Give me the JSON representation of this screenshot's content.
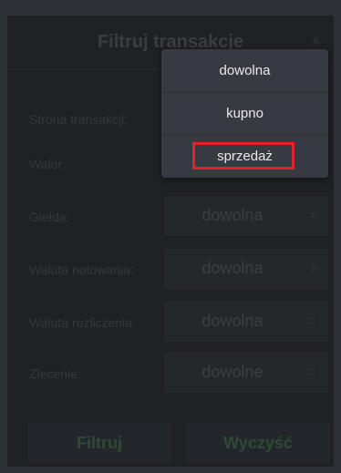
{
  "dialog": {
    "title": "Filtruj transakcje",
    "close_glyph": "×"
  },
  "rows": [
    {
      "label": "Strona transakcji:",
      "value": "",
      "has_box": false
    },
    {
      "label": "Walor:",
      "value": "",
      "has_box": false
    },
    {
      "label": "Giełda:",
      "value": "dowolna"
    },
    {
      "label": "Waluta notowania:",
      "value": "dowolna"
    },
    {
      "label": "Waluta rozliczenia:",
      "value": "dowolna"
    },
    {
      "label": "Zlecenie:",
      "value": "dowolne"
    }
  ],
  "buttons": {
    "filter_label": "Filtruj",
    "clear_label": "Wyczyść"
  },
  "dropdown": {
    "options": [
      "dowolna",
      "kupno",
      "sprzedaż"
    ],
    "highlighted_index": 2
  },
  "colors": {
    "highlight": "#e2232a",
    "menu_bg": "#373a40"
  },
  "icons": {
    "chevron": "chevron-right-icon",
    "close": "close-icon"
  }
}
